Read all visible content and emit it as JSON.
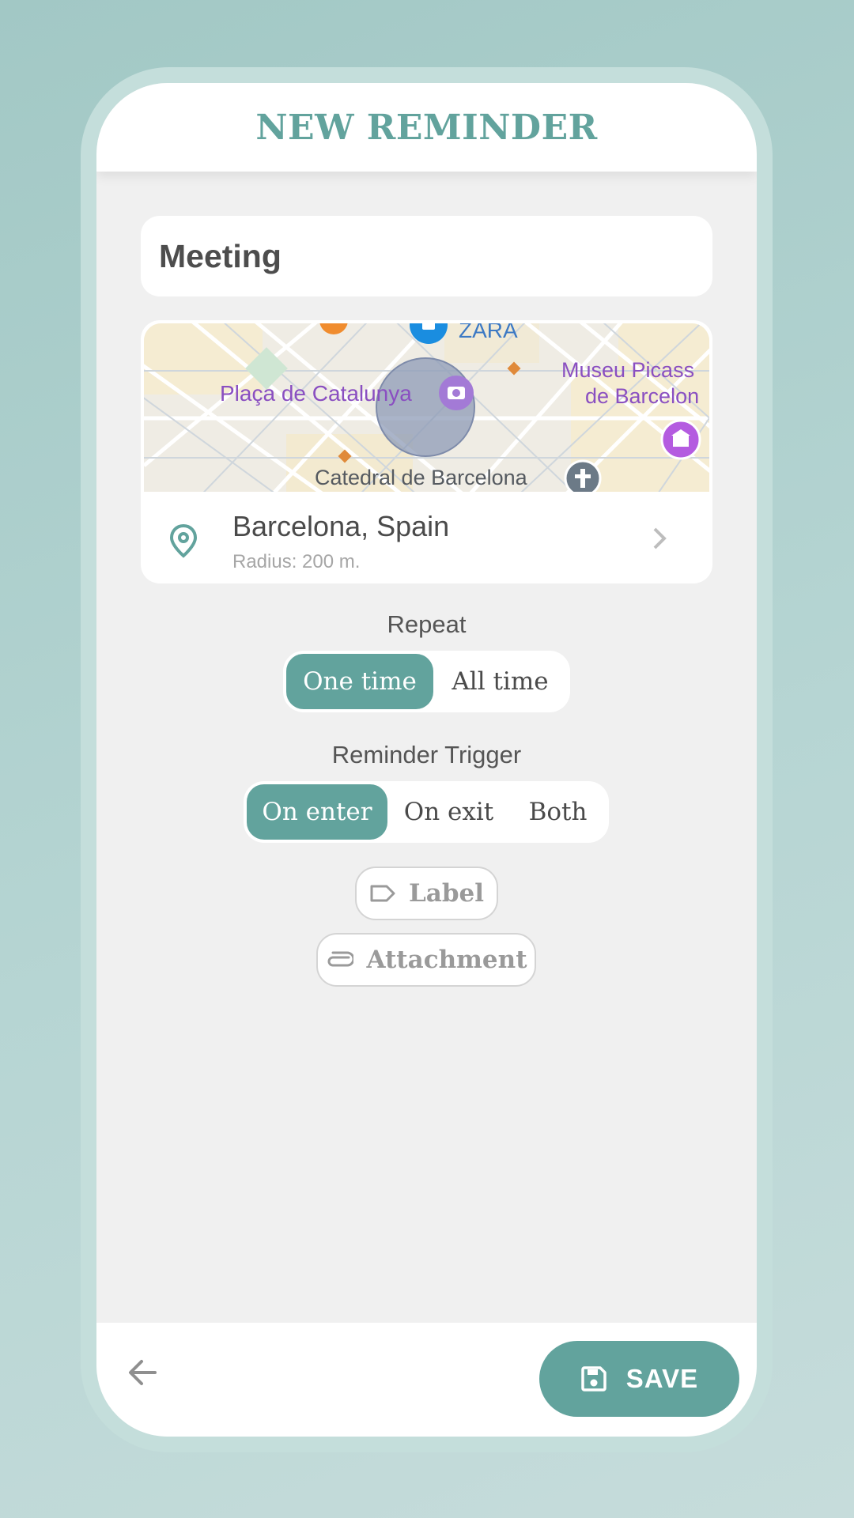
{
  "header": {
    "title": "NEW REMINDER"
  },
  "reminder": {
    "title": "Meeting"
  },
  "map": {
    "labels": {
      "zara": "ZARA",
      "placa": "Plaça de Catalunya",
      "museu_line1": "Museu Picass",
      "museu_line2": "de Barcelon",
      "catedral": "Catedral de Barcelona"
    },
    "icons": [
      "store-icon",
      "camera-icon",
      "museum-icon",
      "church-icon",
      "metro-icon"
    ]
  },
  "location": {
    "name": "Barcelona, Spain",
    "radius": "Radius: 200 m.",
    "icon": "location-pin-icon"
  },
  "repeat": {
    "label": "Repeat",
    "options": [
      "One time",
      "All time"
    ],
    "selected": "One time"
  },
  "trigger": {
    "label": "Reminder Trigger",
    "options": [
      "On enter",
      "On exit",
      "Both"
    ],
    "selected": "On enter"
  },
  "extras": {
    "label_button": "Label",
    "attachment_button": "Attachment"
  },
  "footer": {
    "save_label": "SAVE",
    "back_icon": "arrow-left-icon",
    "save_icon": "floppy-disk-icon"
  },
  "colors": {
    "accent": "#62a39d",
    "background": "#f0f0f0",
    "page_bg": "#a9ccc9"
  }
}
